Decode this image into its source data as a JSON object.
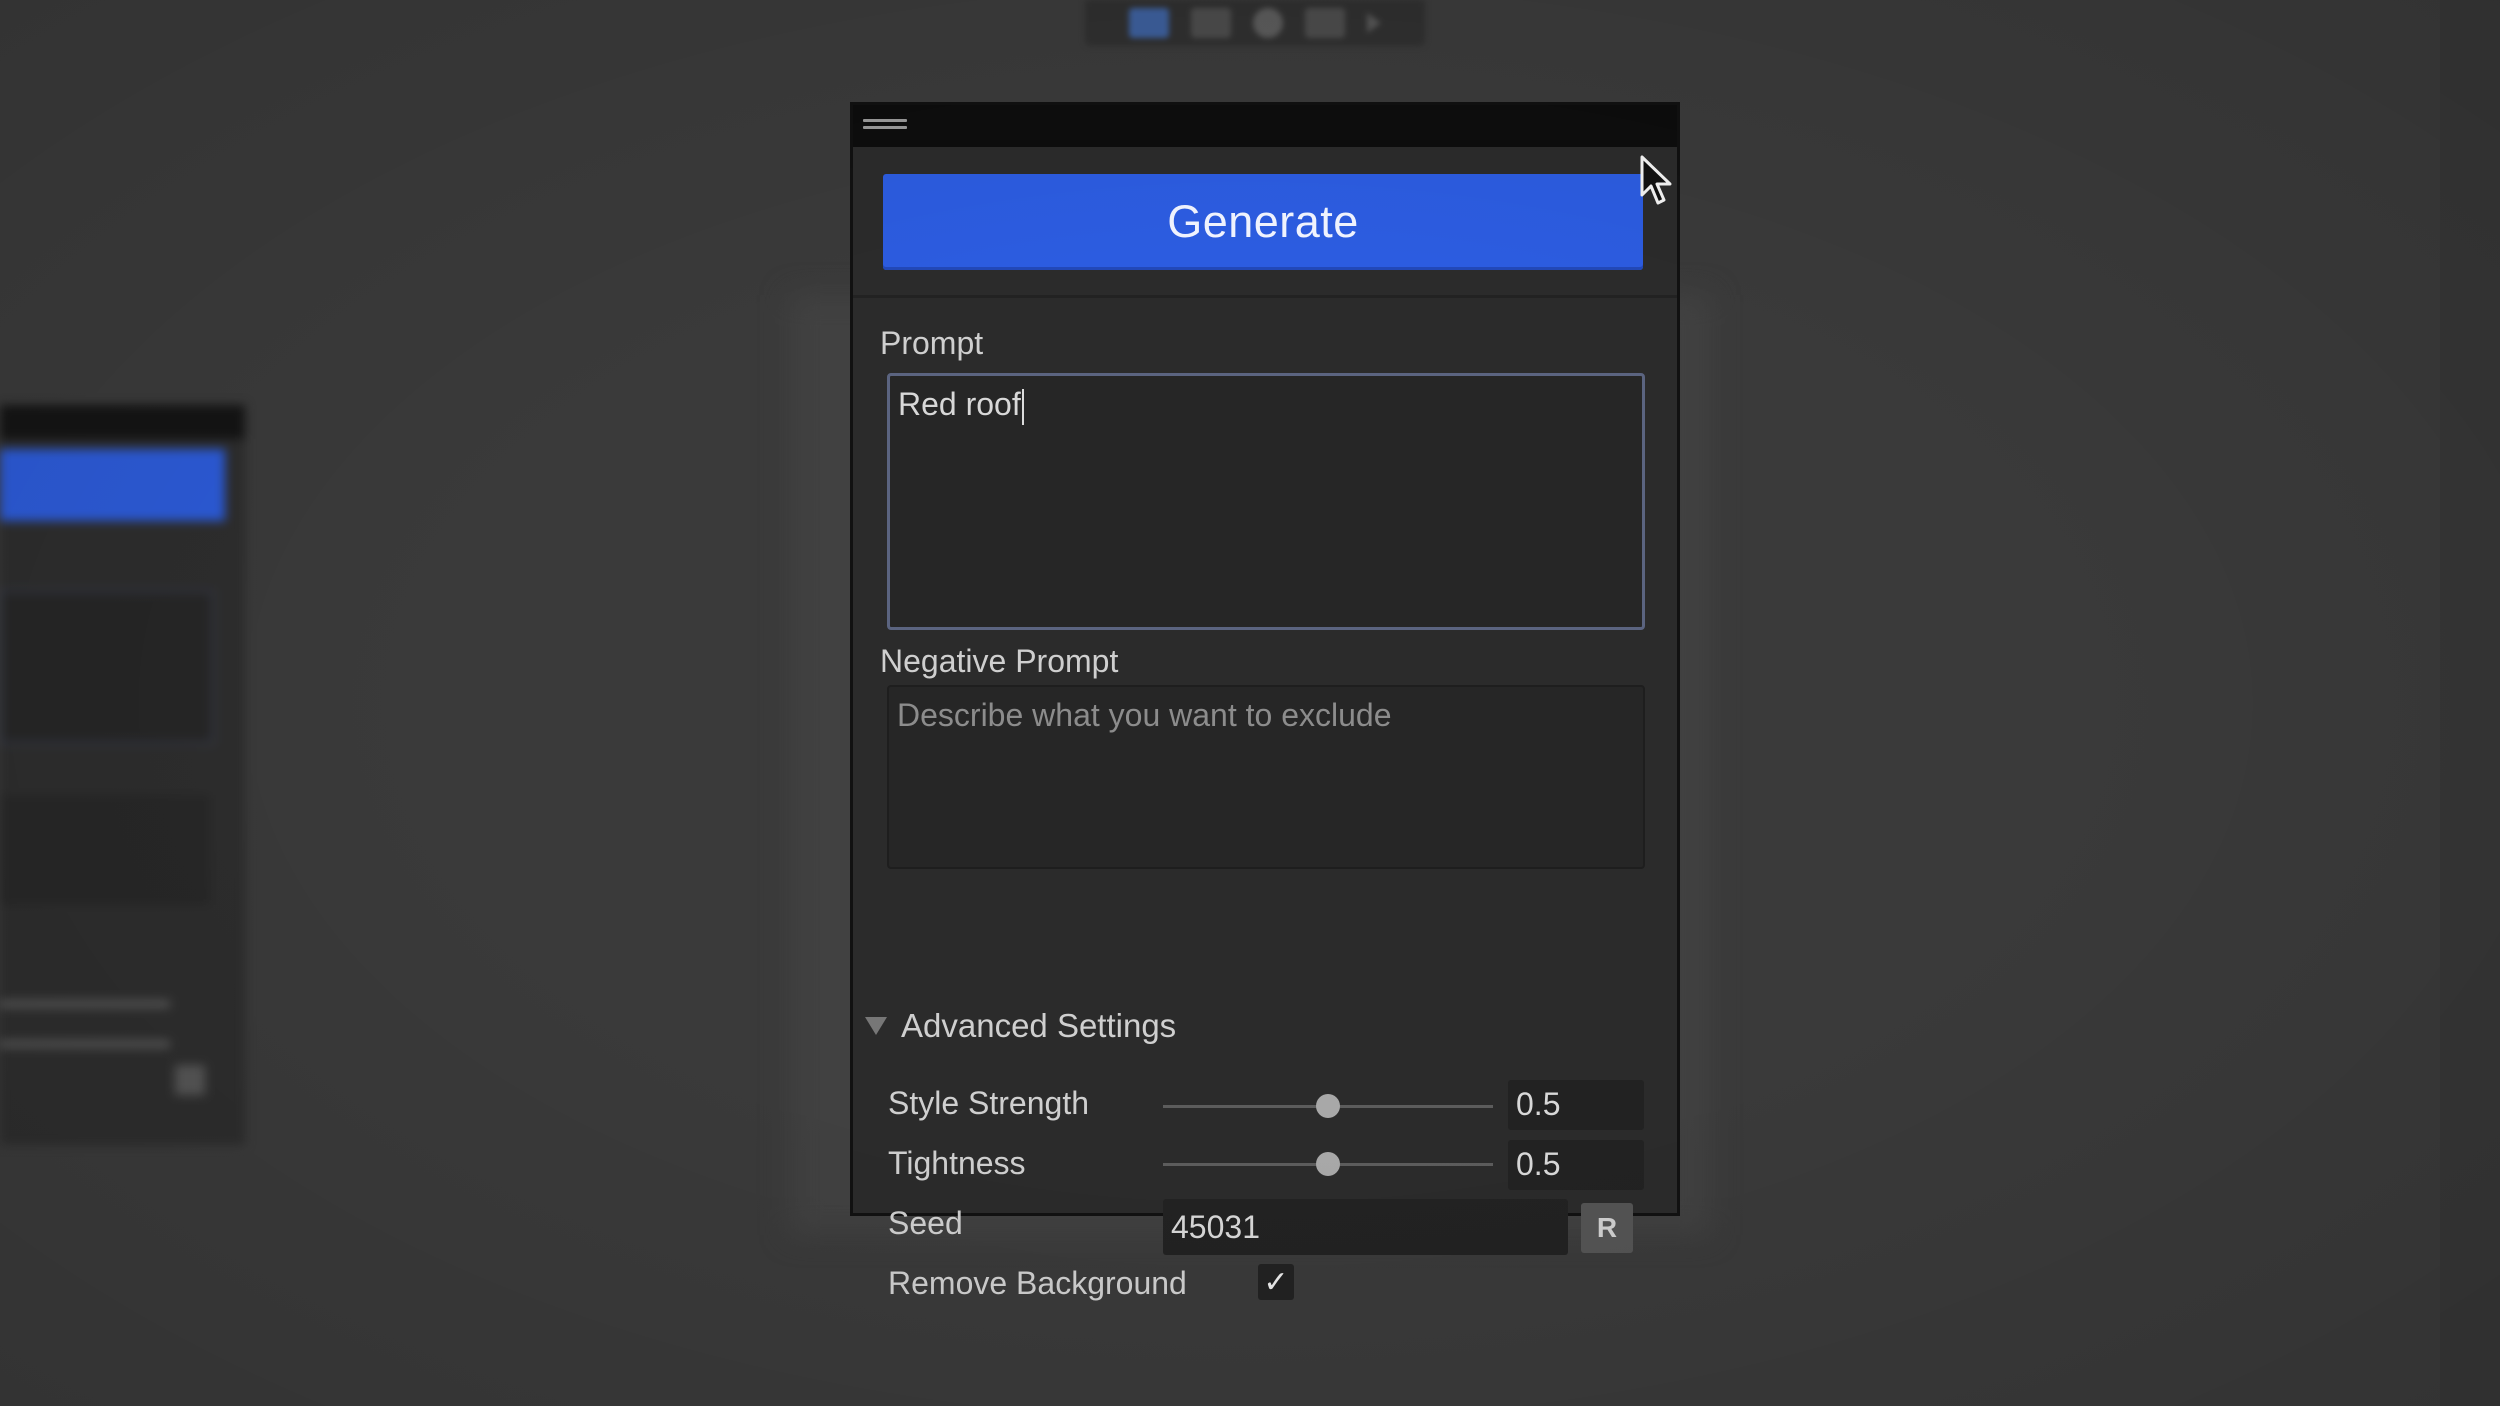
{
  "panel": {
    "generate_label": "Generate",
    "prompt": {
      "label": "Prompt",
      "value": "Red roof",
      "placeholder": ""
    },
    "negative_prompt": {
      "label": "Negative Prompt",
      "value": "",
      "placeholder": "Describe what you want to exclude"
    },
    "advanced_settings": {
      "label": "Advanced Settings",
      "expanded": true,
      "style_strength": {
        "label": "Style Strength",
        "value": "0.5",
        "slider_fraction": 0.5
      },
      "tightness": {
        "label": "Tightness",
        "value": "0.5",
        "slider_fraction": 0.5
      },
      "seed": {
        "label": "Seed",
        "value": "45031",
        "randomize_label": "R"
      },
      "remove_background": {
        "label": "Remove Background",
        "checked": true,
        "check_glyph": "✓"
      }
    }
  },
  "colors": {
    "generate_button": "#2c5ce0",
    "panel_background": "#2b2b2b",
    "page_background": "#3a3a3a"
  },
  "icons": [
    "drag-handle-icon",
    "collapse-triangle-icon",
    "checkmark-icon",
    "mouse-pointer-icon"
  ]
}
